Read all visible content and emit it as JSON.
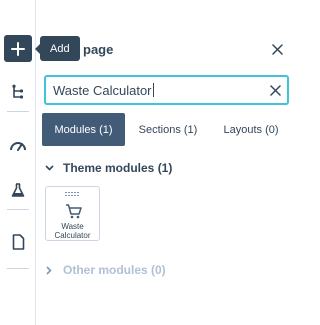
{
  "rail": {
    "add_icon": "plus-icon",
    "items": [
      {
        "name": "tree-icon"
      },
      {
        "name": "gauge-icon"
      },
      {
        "name": "flask-icon"
      },
      {
        "name": "document-icon"
      }
    ]
  },
  "tooltip": {
    "label": "Add"
  },
  "panel": {
    "title": "page",
    "close_icon": "close-icon"
  },
  "search": {
    "value": "Waste Calculator",
    "clear_icon": "close-icon"
  },
  "tabs": [
    {
      "label": "Modules (1)",
      "active": true
    },
    {
      "label": "Sections (1)",
      "active": false
    },
    {
      "label": "Layouts (0)",
      "active": false
    }
  ],
  "theme_modules": {
    "label": "Theme modules (1)",
    "expanded": true,
    "items": [
      {
        "label_line1": "Waste",
        "label_line2": "Calculator",
        "icon": "cart-icon"
      }
    ]
  },
  "other_modules": {
    "label": "Other modules (0)",
    "expanded": false
  },
  "colors": {
    "dark": "#33475b",
    "active_tab": "#425b76",
    "focus_border": "#3fc3d9",
    "muted": "#b0c1d4"
  }
}
